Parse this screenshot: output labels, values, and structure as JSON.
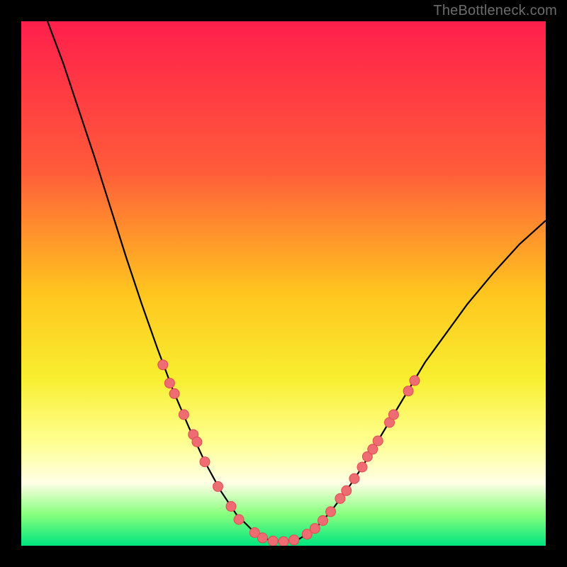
{
  "watermark": "TheBottleneck.com",
  "chart_data": {
    "type": "line",
    "title": "",
    "xlabel": "",
    "ylabel": "",
    "xlim": [
      0,
      100
    ],
    "ylim": [
      0,
      100
    ],
    "gradient_stops": [
      {
        "offset": 0.0,
        "color": "#ff1f4b"
      },
      {
        "offset": 0.28,
        "color": "#ff5a3a"
      },
      {
        "offset": 0.52,
        "color": "#ffc61f"
      },
      {
        "offset": 0.68,
        "color": "#f8ee2f"
      },
      {
        "offset": 0.8,
        "color": "#ffff8f"
      },
      {
        "offset": 0.88,
        "color": "#ffffe6"
      },
      {
        "offset": 0.94,
        "color": "#88ff7e"
      },
      {
        "offset": 1.0,
        "color": "#00e57f"
      }
    ],
    "curve_points": [
      {
        "x": 5.0,
        "y": 100.0
      },
      {
        "x": 8.0,
        "y": 92.0
      },
      {
        "x": 11.0,
        "y": 83.0
      },
      {
        "x": 14.0,
        "y": 74.0
      },
      {
        "x": 17.0,
        "y": 64.5
      },
      {
        "x": 20.0,
        "y": 55.0
      },
      {
        "x": 23.0,
        "y": 46.0
      },
      {
        "x": 26.0,
        "y": 37.5
      },
      {
        "x": 29.0,
        "y": 29.5
      },
      {
        "x": 32.0,
        "y": 22.5
      },
      {
        "x": 35.0,
        "y": 16.0
      },
      {
        "x": 38.0,
        "y": 10.5
      },
      {
        "x": 41.0,
        "y": 6.0
      },
      {
        "x": 44.0,
        "y": 3.0
      },
      {
        "x": 47.0,
        "y": 1.2
      },
      {
        "x": 50.0,
        "y": 0.8
      },
      {
        "x": 53.0,
        "y": 1.3
      },
      {
        "x": 56.0,
        "y": 3.2
      },
      {
        "x": 59.0,
        "y": 6.5
      },
      {
        "x": 62.0,
        "y": 10.5
      },
      {
        "x": 65.0,
        "y": 15.0
      },
      {
        "x": 68.0,
        "y": 20.0
      },
      {
        "x": 71.0,
        "y": 25.0
      },
      {
        "x": 74.0,
        "y": 30.0
      },
      {
        "x": 77.0,
        "y": 35.0
      },
      {
        "x": 81.0,
        "y": 40.5
      },
      {
        "x": 85.0,
        "y": 46.0
      },
      {
        "x": 90.0,
        "y": 52.0
      },
      {
        "x": 95.0,
        "y": 57.5
      },
      {
        "x": 100.0,
        "y": 62.0
      }
    ],
    "marker_points_left": [
      {
        "x": 27.0,
        "y": 34.5
      },
      {
        "x": 28.3,
        "y": 31.0
      },
      {
        "x": 29.2,
        "y": 29.0
      },
      {
        "x": 31.0,
        "y": 25.0
      },
      {
        "x": 32.8,
        "y": 21.2
      },
      {
        "x": 33.5,
        "y": 19.8
      },
      {
        "x": 35.0,
        "y": 16.0
      },
      {
        "x": 37.5,
        "y": 11.3
      },
      {
        "x": 40.0,
        "y": 7.5
      },
      {
        "x": 41.5,
        "y": 5.0
      }
    ],
    "marker_points_bottom": [
      {
        "x": 44.5,
        "y": 2.5
      },
      {
        "x": 46.0,
        "y": 1.5
      },
      {
        "x": 48.0,
        "y": 0.9
      },
      {
        "x": 50.0,
        "y": 0.8
      },
      {
        "x": 52.0,
        "y": 1.1
      },
      {
        "x": 54.5,
        "y": 2.2
      },
      {
        "x": 56.0,
        "y": 3.3
      },
      {
        "x": 57.5,
        "y": 4.8
      }
    ],
    "marker_points_right": [
      {
        "x": 59.0,
        "y": 6.5
      },
      {
        "x": 60.8,
        "y": 9.0
      },
      {
        "x": 62.0,
        "y": 10.5
      },
      {
        "x": 63.5,
        "y": 12.8
      },
      {
        "x": 65.0,
        "y": 15.0
      },
      {
        "x": 66.0,
        "y": 17.0
      },
      {
        "x": 67.0,
        "y": 18.4
      },
      {
        "x": 68.0,
        "y": 20.0
      },
      {
        "x": 70.2,
        "y": 23.5
      },
      {
        "x": 71.0,
        "y": 25.0
      },
      {
        "x": 73.8,
        "y": 29.5
      },
      {
        "x": 75.0,
        "y": 31.5
      }
    ],
    "marker_style": {
      "fill": "#ed6d72",
      "stroke": "#e04a50",
      "r": 7
    },
    "curve_style": {
      "stroke": "#000000",
      "width": 2.2
    }
  }
}
